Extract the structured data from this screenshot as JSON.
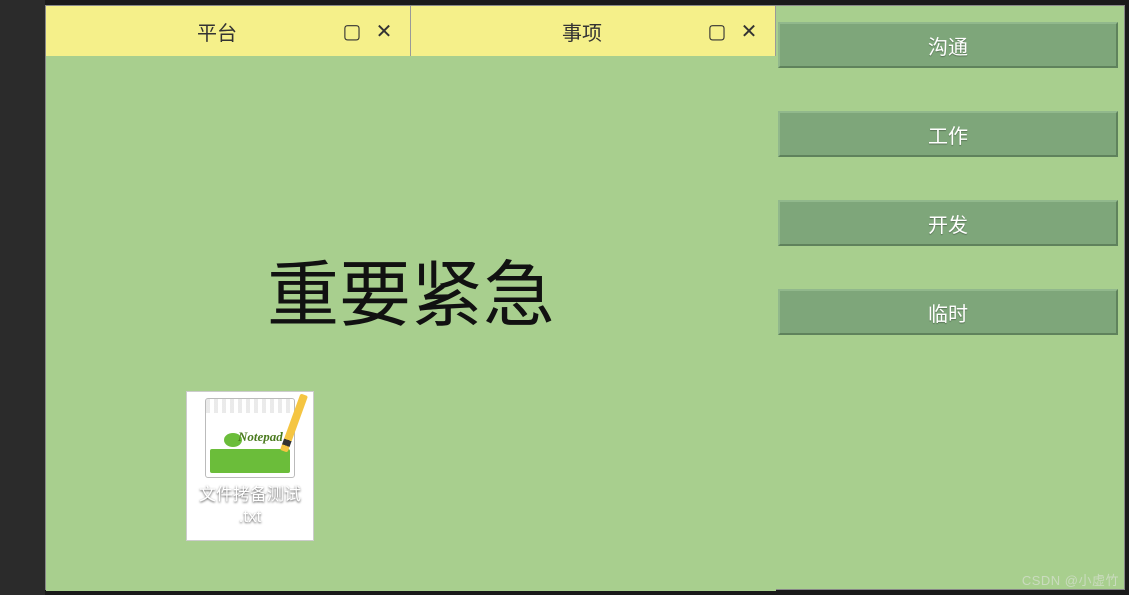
{
  "tabs": [
    {
      "title": "平台"
    },
    {
      "title": "事项"
    }
  ],
  "icons": {
    "maximize": "▢",
    "close": "✕"
  },
  "canvas": {
    "heading": "重要紧急",
    "file": {
      "label": "文件拷备测试\n.txt",
      "icon_word": "Notepad"
    }
  },
  "side_buttons": [
    "沟通",
    "工作",
    "开发",
    "临时"
  ],
  "watermark": "CSDN @小虚竹"
}
